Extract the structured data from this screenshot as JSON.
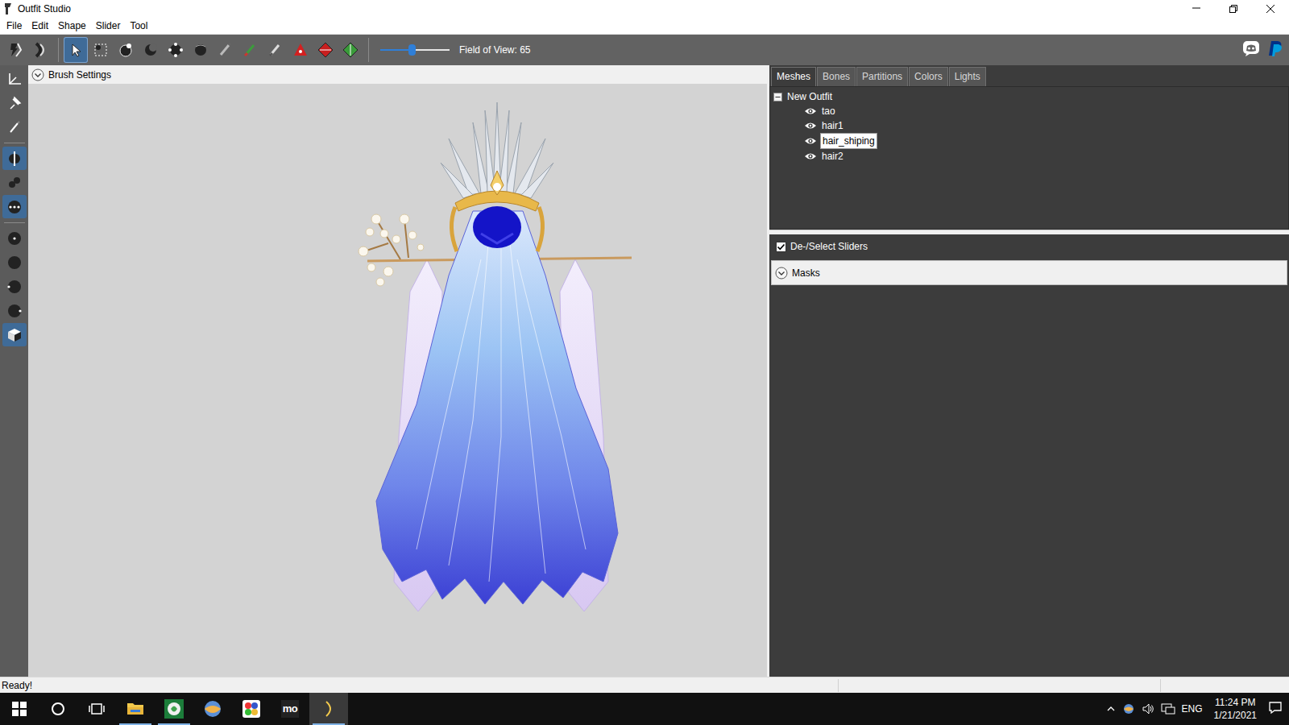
{
  "window": {
    "title": "Outfit Studio"
  },
  "menu": [
    "File",
    "Edit",
    "Shape",
    "Slider",
    "Tool"
  ],
  "toolbar": {
    "tools": [
      {
        "selected": false
      },
      {
        "selected": false
      },
      {
        "selected": true
      },
      {
        "selected": false
      },
      {
        "selected": false
      },
      {
        "selected": false
      },
      {
        "selected": false
      },
      {
        "selected": false
      },
      {
        "selected": false
      },
      {
        "selected": false
      },
      {
        "selected": false
      },
      {
        "selected": false
      },
      {
        "selected": false
      },
      {
        "selected": false
      }
    ],
    "fov": {
      "label": "Field of View: 65",
      "level": 0.45
    }
  },
  "left_tools": [
    {
      "selected": false
    },
    {
      "selected": false
    },
    {
      "selected": false
    },
    {
      "selected": true
    },
    {
      "selected": false
    },
    {
      "selected": true
    },
    {
      "selected": false
    },
    {
      "selected": false
    },
    {
      "selected": false
    },
    {
      "selected": false
    },
    {
      "selected": true
    }
  ],
  "viewport": {
    "brush_settings": {
      "label": "Brush Settings",
      "expanded": false
    }
  },
  "panel": {
    "tabs": [
      {
        "label": "Meshes",
        "selected": true
      },
      {
        "label": "Bones",
        "selected": false
      },
      {
        "label": "Partitions",
        "selected": false
      },
      {
        "label": "Colors",
        "selected": false
      },
      {
        "label": "Lights",
        "selected": false
      }
    ],
    "tree": {
      "root": {
        "label": "New Outfit",
        "expanded": true
      },
      "items": [
        {
          "label": "tao",
          "visible": true,
          "selected": false
        },
        {
          "label": "hair1",
          "visible": true,
          "selected": false
        },
        {
          "label": "hair_shiping",
          "visible": true,
          "selected": true
        },
        {
          "label": "hair2",
          "visible": true,
          "selected": false
        }
      ]
    }
  },
  "sliders": {
    "label": "De-/Select Sliders",
    "checked": true
  },
  "masks": {
    "label": "Masks",
    "expanded": false
  },
  "status_bar": {
    "text": "Ready!"
  },
  "taskbar": {
    "apps": [
      {
        "kind": "explorer",
        "running": true,
        "active": false
      },
      {
        "kind": "green",
        "running": true,
        "active": false
      },
      {
        "kind": "globe",
        "running": false,
        "active": false
      },
      {
        "kind": "colors",
        "running": false,
        "active": false
      },
      {
        "kind": "mo",
        "label": "mo",
        "running": false,
        "active": false
      },
      {
        "kind": "studio",
        "running": true,
        "active": true
      }
    ],
    "language": "ENG",
    "time": "11:24 PM",
    "date": "1/21/2021"
  }
}
